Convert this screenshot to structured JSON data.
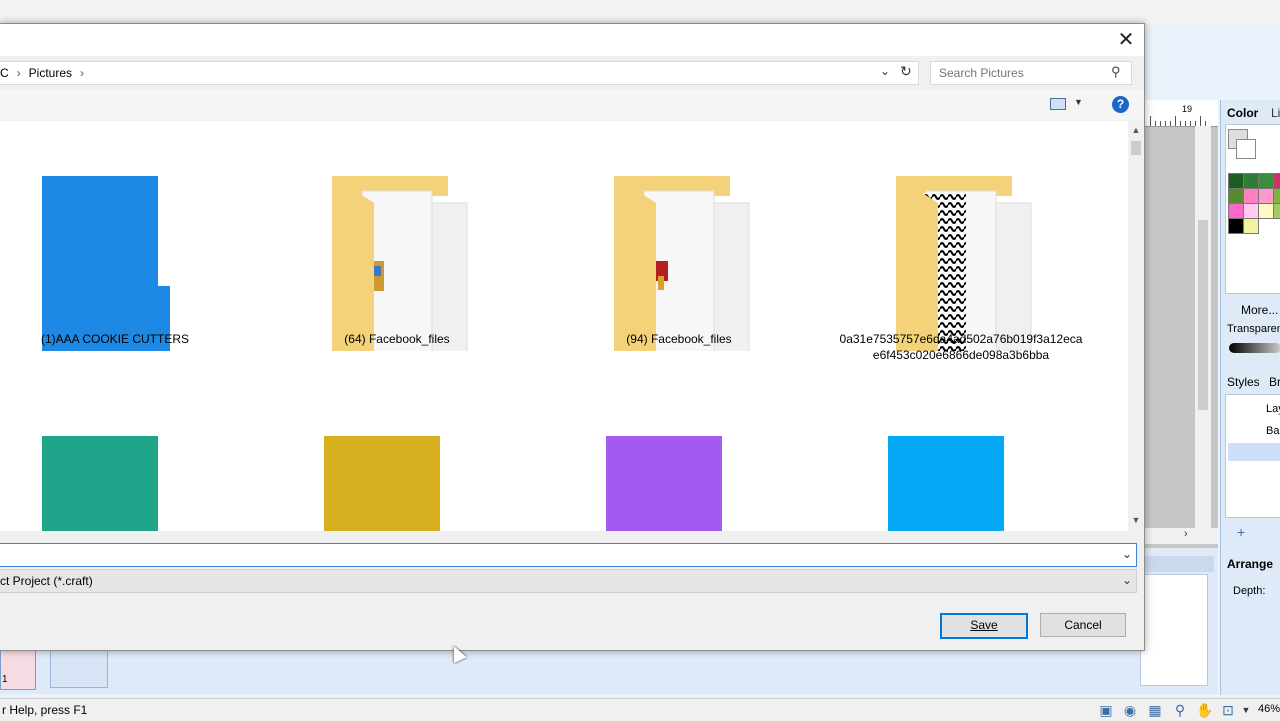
{
  "dialog": {
    "breadcrumb": [
      "C",
      "Pictures"
    ],
    "search": {
      "placeholder": "Search Pictures"
    },
    "files": [
      {
        "label": "(1)AAA COOKIE CUTTERS",
        "color": "#1e88e5",
        "style": "solid"
      },
      {
        "label": "(64) Facebook_files",
        "color": "#f3d27a",
        "style": "open-photo"
      },
      {
        "label": "(94) Facebook_files",
        "color": "#f3d27a",
        "style": "open-photo2"
      },
      {
        "label": "0a31e7535757e6da4ad502a76b019f3a12eca\ne6f453c020e6866de098a3b6bba",
        "color": "#f3d27a",
        "style": "open-pattern"
      },
      {
        "label": "",
        "color": "#1fa58a",
        "style": "solid"
      },
      {
        "label": "",
        "color": "#d6b01e",
        "style": "solid"
      },
      {
        "label": "",
        "color": "#a35af2",
        "style": "solid"
      },
      {
        "label": "",
        "color": "#06a8f6",
        "style": "solid"
      }
    ],
    "filename": {
      "value": ""
    },
    "filetype": {
      "value": "ct Project (*.craft)"
    },
    "buttons": {
      "save": "Save",
      "cancel": "Cancel"
    },
    "close_glyph": "✕",
    "help_glyph": "?"
  },
  "app": {
    "ruler_label": "19",
    "color_panel": {
      "title": "Color",
      "tab2": "Li",
      "more_label": "More...",
      "transparency_label": "Transparen"
    },
    "styles_panel": {
      "title": "Styles",
      "tab2": "Br",
      "layer1": "Lay",
      "layer2": "Bac"
    },
    "arrange_panel": {
      "title": "Arrange",
      "depth_label": "Depth:"
    },
    "thumb1_label": "1",
    "status_text": "r Help, press F1",
    "zoom": "46%",
    "swatches": [
      "#1b5e20",
      "#2e7d32",
      "#388e3c",
      "#cc3366",
      "#558b2f",
      "#ff80c0",
      "#ff99cc",
      "#7cb342",
      "#ff66cc",
      "#ffccee",
      "#fff9c4",
      "#9ccc65",
      "#000000",
      "#f0f4a0"
    ]
  }
}
